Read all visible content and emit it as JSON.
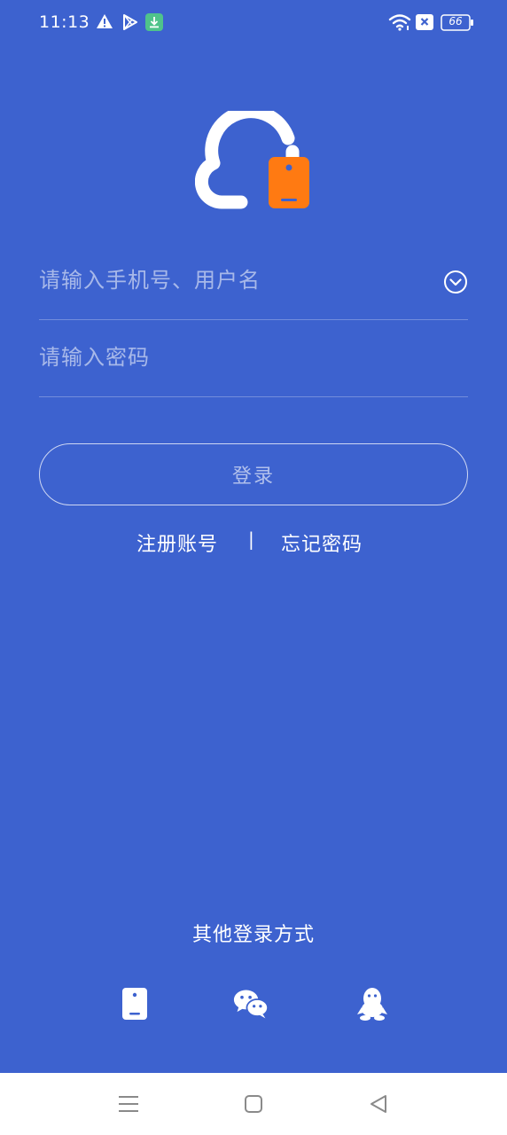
{
  "status_bar": {
    "time": "11:13",
    "battery": "66",
    "icons": [
      "warning-icon",
      "play-store-icon",
      "download-icon",
      "wifi-icon",
      "sim-off-icon",
      "battery-icon"
    ]
  },
  "logo": {
    "icon": "cloud-phone-logo",
    "colors": {
      "cloud": "#ffffff",
      "phone": "#ff7a12"
    }
  },
  "form": {
    "account_placeholder": "请输入手机号、用户名",
    "account_value": "",
    "password_placeholder": "请输入密码",
    "password_value": "",
    "dropdown_icon": "chevron-down-circle-icon",
    "login_label": "登录"
  },
  "links": {
    "register": "注册账号",
    "separator": "|",
    "forgot": "忘记密码"
  },
  "other_login": {
    "title": "其他登录方式",
    "methods": [
      "phone-icon",
      "wechat-icon",
      "qq-icon"
    ]
  },
  "nav_bar": {
    "buttons": [
      "menu-icon",
      "home-icon",
      "back-icon"
    ]
  },
  "colors": {
    "background": "#3d62cf",
    "accent": "#ff7a12",
    "nav_background": "#ffffff"
  }
}
